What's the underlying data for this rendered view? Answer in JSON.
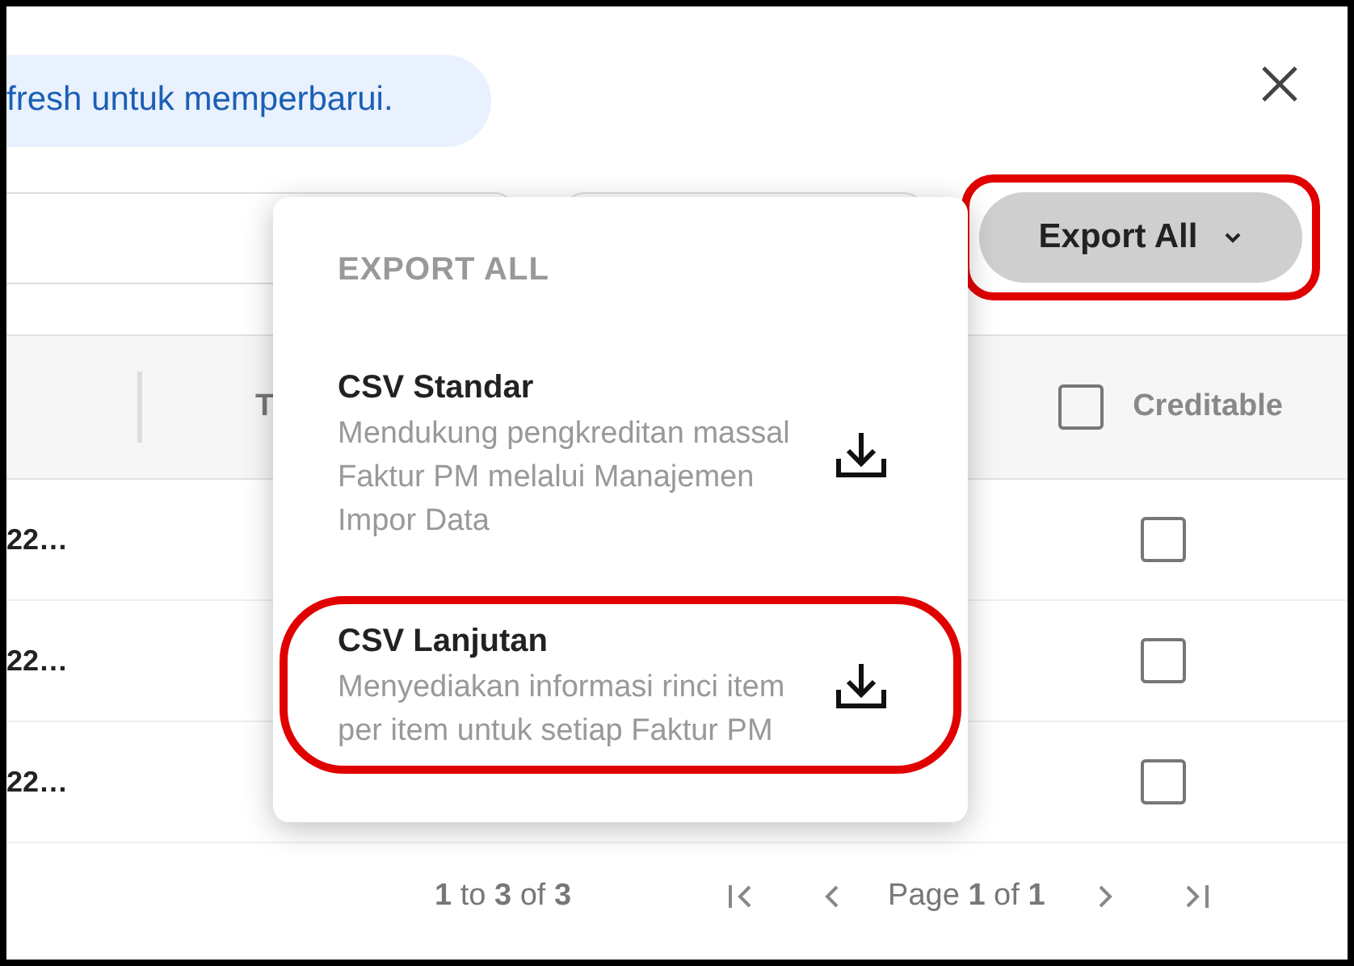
{
  "banner": {
    "text": "fresh untuk memperbarui."
  },
  "filters": [
    {
      "kind": "field"
    },
    {
      "kind": "field"
    }
  ],
  "export_button": {
    "label": "Export All",
    "highlighted": true
  },
  "table": {
    "columns": [
      {
        "label": "T"
      },
      {
        "label": "Creditable",
        "checked": false
      }
    ],
    "rows": [
      {
        "cell": "22…",
        "checked": false
      },
      {
        "cell": "22…",
        "checked": false
      },
      {
        "cell": "22…",
        "checked": false
      }
    ]
  },
  "export_menu": {
    "heading": "EXPORT ALL",
    "options": [
      {
        "title": "CSV Standar",
        "description": "Mendukung pengkreditan massal Faktur PM melalui Manajemen Impor Data",
        "highlighted": false
      },
      {
        "title": "CSV Lanjutan",
        "description": "Menyediakan informasi rinci item per item untuk setiap Faktur PM",
        "highlighted": true
      }
    ]
  },
  "pagination": {
    "range": "**1** to **3** of **3**",
    "page": "Page **1** of **1**"
  }
}
